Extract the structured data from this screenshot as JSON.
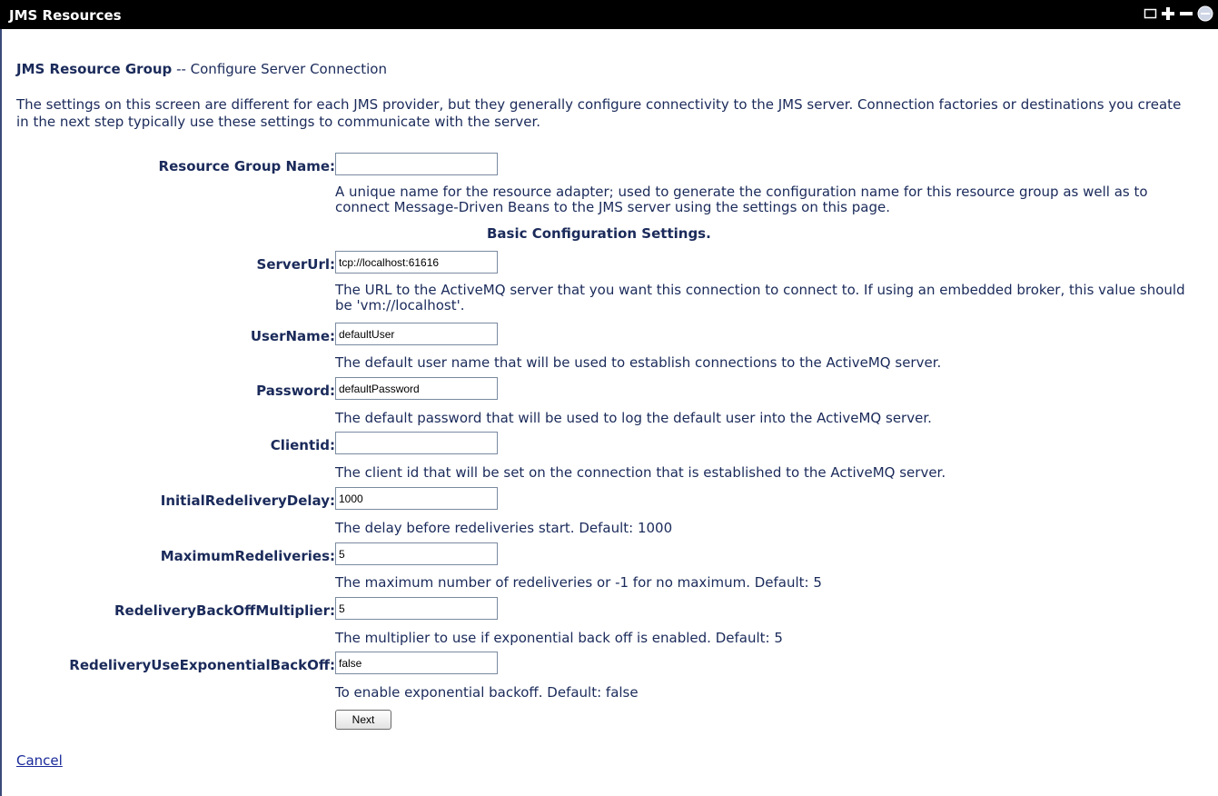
{
  "window": {
    "title": "JMS Resources",
    "controls": [
      "restore-icon",
      "plus-icon",
      "minus-icon",
      "help-icon"
    ]
  },
  "page": {
    "heading_bold": "JMS Resource Group",
    "heading_rest": " -- Configure Server Connection",
    "intro": "The settings on this screen are different for each JMS provider, but they generally configure connectivity to the JMS server. Connection factories or destinations you create in the next step typically use these settings to communicate with the server.",
    "section_title": "Basic Configuration Settings."
  },
  "fields": [
    {
      "label": "Resource Group Name:",
      "value": "",
      "help": "A unique name for the resource adapter; used to generate the configuration name for this resource group as well as to connect Message-Driven Beans to the JMS server using the settings on this page."
    },
    {
      "label": "ServerUrl:",
      "value": "tcp://localhost:61616",
      "help": "The URL to the ActiveMQ server that you want this connection to connect to. If using an embedded broker, this value should be 'vm://localhost'."
    },
    {
      "label": "UserName:",
      "value": "defaultUser",
      "help": "The default user name that will be used to establish connections to the ActiveMQ server."
    },
    {
      "label": "Password:",
      "value": "defaultPassword",
      "help": "The default password that will be used to log the default user into the ActiveMQ server."
    },
    {
      "label": "Clientid:",
      "value": "",
      "help": "The client id that will be set on the connection that is established to the ActiveMQ server."
    },
    {
      "label": "InitialRedeliveryDelay:",
      "value": "1000",
      "help": "The delay before redeliveries start. Default: 1000"
    },
    {
      "label": "MaximumRedeliveries:",
      "value": "5",
      "help": "The maximum number of redeliveries or -1 for no maximum. Default: 5"
    },
    {
      "label": "RedeliveryBackOffMultiplier:",
      "value": "5",
      "help": "The multiplier to use if exponential back off is enabled. Default: 5"
    },
    {
      "label": "RedeliveryUseExponentialBackOff:",
      "value": "false",
      "help": "To enable exponential backoff. Default: false"
    }
  ],
  "actions": {
    "next_label": "Next",
    "cancel_label": "Cancel"
  }
}
